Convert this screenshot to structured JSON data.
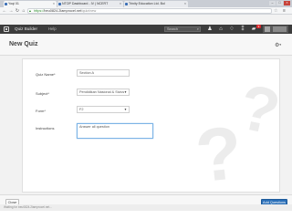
{
  "browser": {
    "tabs": [
      {
        "label": "Yoqi 01",
        "active": true
      },
      {
        "label": "NTOP Dashboard - IV | NCERT",
        "active": false
      },
      {
        "label": "Trinity Education Ltd. Bol",
        "active": false
      }
    ],
    "url": {
      "scheme": "https://",
      "host": "beu0824.2lamprocel.net",
      "path": "/quiz/new"
    }
  },
  "app": {
    "title": "Quiz Builder",
    "help": "Help",
    "search_placeholder": "Search",
    "notification_count": "9"
  },
  "page": {
    "title": "New Quiz"
  },
  "form": {
    "quiz_name": {
      "label": "Quiz Name*",
      "value": "Section A"
    },
    "subject": {
      "label": "Subject*",
      "value": "Pendidikan Nasional & Sivics"
    },
    "form_field": {
      "label": "Form*",
      "value": "F2"
    },
    "instructions": {
      "label": "Instructions",
      "value": "Answer all question"
    }
  },
  "footer": {
    "close_label": "Close",
    "add_label": "Add Questions"
  },
  "status": {
    "text": "Waiting for beu0824.2lamprocel.net..."
  },
  "colors": {
    "primary": "#2a6fb8",
    "appbar": "#3c3c3c",
    "badge": "#d9262a"
  }
}
